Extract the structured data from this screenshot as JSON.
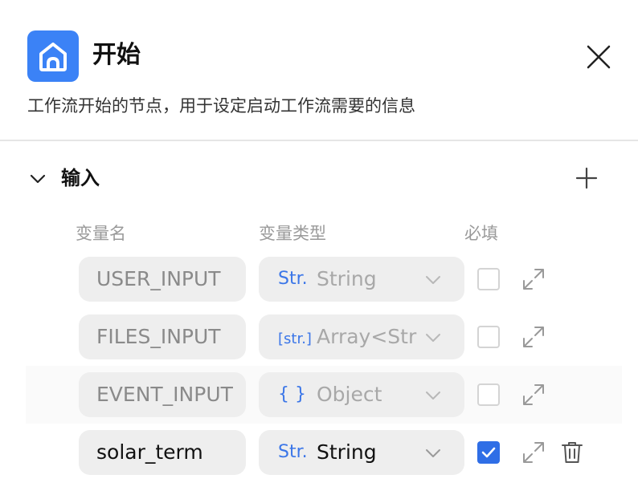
{
  "header": {
    "icon": "home-icon",
    "title": "开始",
    "description": "工作流开始的节点，用于设定启动工作流需要的信息",
    "accent_color": "#3b82f6"
  },
  "section": {
    "title": "输入",
    "expanded": true
  },
  "columns": {
    "name": "变量名",
    "type": "变量类型",
    "required": "必填"
  },
  "variables": [
    {
      "name": "USER_INPUT",
      "type_tag": "Str.",
      "type": "String",
      "required": false,
      "editable": false
    },
    {
      "name": "FILES_INPUT",
      "type_tag": "[str.]",
      "type": "Array<Str",
      "required": false,
      "editable": false
    },
    {
      "name": "EVENT_INPUT",
      "type_tag": "{ }",
      "type": "Object",
      "required": false,
      "editable": false
    },
    {
      "name": "solar_term",
      "type_tag": "Str.",
      "type": "String",
      "required": true,
      "editable": true
    }
  ]
}
